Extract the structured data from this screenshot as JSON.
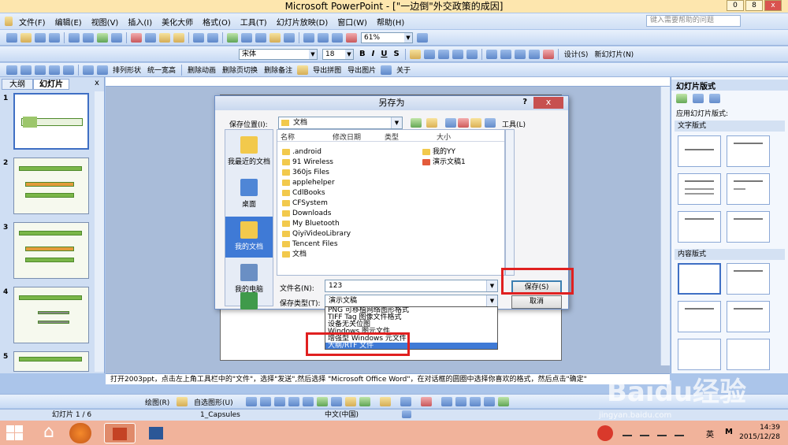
{
  "window": {
    "title": "Microsoft PowerPoint - [\"一边倒\"外交政策的成因]",
    "min": "0",
    "restore": "8",
    "close": "x"
  },
  "menu": {
    "items": [
      "文件(F)",
      "编辑(E)",
      "视图(V)",
      "插入(I)",
      "美化大师",
      "格式(O)",
      "工具(T)",
      "幻灯片放映(D)",
      "窗口(W)",
      "帮助(H)"
    ],
    "help_placeholder": "键入需要帮助的问题"
  },
  "toolbar1": {
    "zoom": "61%"
  },
  "toolbar2": {
    "font": "宋体",
    "size": "18",
    "bold": "B",
    "italic": "I",
    "underline": "U",
    "shadow": "S",
    "design": "设计(S)",
    "new_slide": "新幻灯片(N)"
  },
  "toolbar3": {
    "items": [
      "排列形状",
      "统一宽高",
      "删除动画",
      "删除页切换",
      "删除备注",
      "导出拼图",
      "导出图片",
      "关于"
    ]
  },
  "left_pane": {
    "tab_outline": "大纲",
    "tab_slides": "幻灯片",
    "close": "x",
    "slide_numbers": [
      "1",
      "2",
      "3",
      "4",
      "5"
    ]
  },
  "notes_text": "打开2003ppt，点击左上角工具栏中的\"文件\"，选择\"发送\",然后选择      \"Microsoft  Office Word\"，在对话框的圆圈中选择你喜欢的格式，然后点击\"确定\"",
  "right_pane": {
    "title": "幻灯片版式",
    "apply": "应用幻灯片版式:",
    "section_text": "文字版式",
    "section_content": "内容版式"
  },
  "dialog": {
    "title": "另存为",
    "help": "?",
    "close": "x",
    "save_in_label": "保存位置(I):",
    "save_in_value": "文档",
    "tools": "工具(L)",
    "places": [
      "我最近的文档",
      "桌面",
      "我的文档",
      "我的电脑",
      ""
    ],
    "columns": [
      "名称",
      "修改日期",
      "类型",
      "大小"
    ],
    "files_left": [
      ".android",
      "91 Wireless",
      "360js Files",
      "applehelper",
      "CdlBooks",
      "CFSystem",
      "Downloads",
      "My Bluetooth",
      "QiyiVideoLibrary",
      "Tencent Files",
      "文档"
    ],
    "files_right": [
      "我的YY",
      "演示文稿1"
    ],
    "filename_label": "文件名(N):",
    "filename_value": "123",
    "filetype_label": "保存类型(T):",
    "filetype_value": "演示文稿",
    "save": "保存(S)",
    "cancel": "取消",
    "type_options": [
      "PNG 可移植网络图形格式",
      "TIFF Tag 图像文件格式",
      "设备无关位图",
      "Windows 图元文件",
      "增强型 Windows 元文件",
      "大纲/RTF 文件"
    ]
  },
  "drawbar": {
    "draw": "绘图(R)",
    "autoshape": "自选图形(U)"
  },
  "status": {
    "slide": "幻灯片 1 / 6",
    "template": "1_Capsules",
    "lang": "中文(中国)"
  },
  "taskbar": {
    "time": "14:39",
    "date": "2015/12/28",
    "ime": "英"
  },
  "watermark": {
    "text": "Baidu经验",
    "url": "jingyan.baidu.com"
  }
}
